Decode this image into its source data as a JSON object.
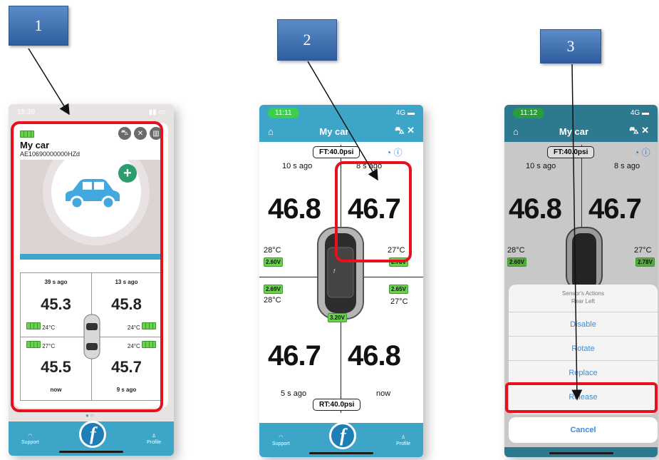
{
  "badges": [
    "1",
    "2",
    "3"
  ],
  "colors": {
    "highlight": "#e8101c",
    "accent": "#3da5c8",
    "battery": "#6ad14d",
    "badge": "#3f72b5"
  },
  "phone1": {
    "status_time": "15:39",
    "car_name": "My car",
    "car_id": "AE10690000000HZd",
    "icons": [
      "car-icon",
      "tools-icon",
      "trash-icon"
    ],
    "tires": [
      {
        "ago": "39 s ago",
        "pressure": "45.3",
        "temp": "24°C"
      },
      {
        "ago": "13 s ago",
        "pressure": "45.8",
        "temp": "24°C"
      },
      {
        "ago": "now",
        "pressure": "45.5",
        "temp": "27°C"
      },
      {
        "ago": "9 s ago",
        "pressure": "45.7",
        "temp": "24°C"
      }
    ],
    "tab_support": "Support",
    "tab_profile": "Profile"
  },
  "phone2": {
    "status_time": "11:11",
    "network": "4G",
    "title": "My car",
    "front_target": "FT:40.0psi",
    "rear_target": "RT:40.0psi",
    "tires": [
      {
        "ago": "10 s ago",
        "pressure": "46.8",
        "temp": "28°C",
        "voltage": "2.60V"
      },
      {
        "ago": "8 s ago",
        "pressure": "46.7",
        "temp": "27°C",
        "voltage": "2.78V"
      },
      {
        "ago": "5 s ago",
        "pressure": "46.7",
        "temp": "28°C",
        "voltage": "2.69V"
      },
      {
        "ago": "now",
        "pressure": "46.8",
        "temp": "27°C",
        "voltage": "2.65V"
      }
    ],
    "center_voltage": "3.20V",
    "tab_support": "Support",
    "tab_profile": "Profile"
  },
  "phone3": {
    "status_time": "11:12",
    "network": "4G",
    "title": "My car",
    "front_target": "FT:40.0psi",
    "tires": [
      {
        "ago": "10 s ago",
        "pressure": "46.8",
        "temp": "28°C",
        "voltage": "2.60V"
      },
      {
        "ago": "8 s ago",
        "pressure": "46.7",
        "temp": "27°C",
        "voltage": "2.78V"
      }
    ],
    "sheet_title": "Sensor's Actions",
    "sheet_subtitle": "Rear Left",
    "actions": [
      "Disable",
      "Rotate",
      "Replace",
      "Release"
    ],
    "cancel": "Cancel"
  }
}
